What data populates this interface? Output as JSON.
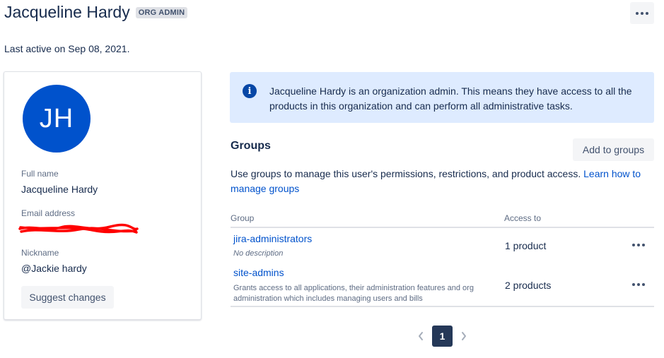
{
  "header": {
    "name": "Jacqueline Hardy",
    "badge": "ORG ADMIN",
    "last_active": "Last active on Sep 08, 2021."
  },
  "profile": {
    "initials": "JH",
    "avatar_color": "#0052cc",
    "full_name_label": "Full name",
    "full_name": "Jacqueline Hardy",
    "email_label": "Email address",
    "nickname_label": "Nickname",
    "nickname": "@Jackie hardy",
    "suggest_label": "Suggest changes"
  },
  "info_banner": {
    "icon": "info-icon",
    "text": "Jacqueline Hardy is an organization admin. This means they have access to all the products in this organization and can perform all administrative tasks."
  },
  "groups": {
    "heading": "Groups",
    "add_label": "Add to groups",
    "description": "Use groups to manage this user's permissions, restrictions, and product access.",
    "learn_link": "Learn how to manage groups",
    "columns": [
      "Group",
      "Access to"
    ],
    "rows": [
      {
        "name": "jira-administrators",
        "description": "No description",
        "access": "1 product"
      },
      {
        "name": "site-admins",
        "description": "Grants access to all applications, their administration features and org administration which includes managing users and bills",
        "access": "2 products"
      }
    ]
  },
  "pagination": {
    "current": "1"
  },
  "colors": {
    "primary": "#0052cc",
    "text": "#172b4d",
    "subtle": "#5e6c84",
    "info_bg": "#deebff",
    "redaction": "#ff0000"
  }
}
